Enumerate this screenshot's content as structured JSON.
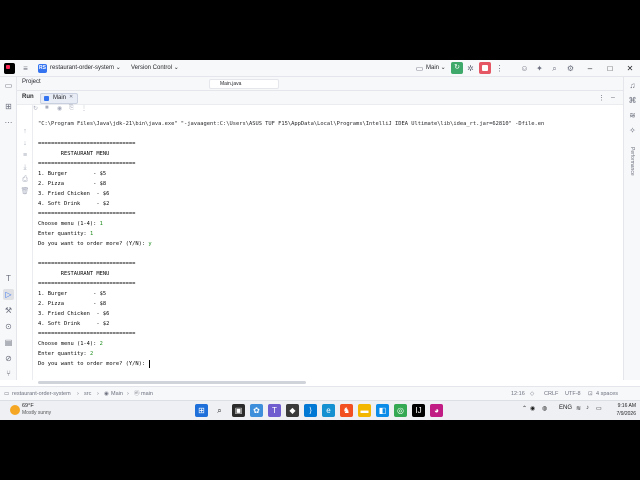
{
  "titlebar": {
    "project_badge": "RS",
    "project_name": "restaurant-order-system",
    "vcs": "Version Control",
    "run_config": "Main"
  },
  "project_row": {
    "label": "Project",
    "tab_label": "Main.java"
  },
  "run_panel": {
    "title": "Run",
    "tab_label": "Main"
  },
  "console": {
    "lines": [
      {
        "text": "\"C:\\Program Files\\Java\\jdk-21\\bin\\java.exe\" \"-javaagent:C:\\Users\\ASUS TUF F15\\AppData\\Local\\Programs\\IntelliJ IDEA Ultimate\\lib\\idea_rt.jar=62810\" -Dfile.en",
        "input": ""
      },
      {
        "text": "",
        "input": ""
      },
      {
        "text": "==============================",
        "input": ""
      },
      {
        "text": "       RESTAURANT MENU",
        "input": ""
      },
      {
        "text": "==============================",
        "input": ""
      },
      {
        "text": "1. Burger        - $5",
        "input": ""
      },
      {
        "text": "2. Pizza         - $8",
        "input": ""
      },
      {
        "text": "3. Fried Chicken  - $6",
        "input": ""
      },
      {
        "text": "4. Soft Drink     - $2",
        "input": ""
      },
      {
        "text": "==============================",
        "input": ""
      },
      {
        "text": "Choose menu (1-4): ",
        "input": "1"
      },
      {
        "text": "Enter quantity: ",
        "input": "1"
      },
      {
        "text": "Do you want to order more? (Y/N): ",
        "input": "y"
      },
      {
        "text": "",
        "input": ""
      },
      {
        "text": "==============================",
        "input": ""
      },
      {
        "text": "       RESTAURANT MENU",
        "input": ""
      },
      {
        "text": "==============================",
        "input": ""
      },
      {
        "text": "1. Burger        - $5",
        "input": ""
      },
      {
        "text": "2. Pizza         - $8",
        "input": ""
      },
      {
        "text": "3. Fried Chicken  - $6",
        "input": ""
      },
      {
        "text": "4. Soft Drink     - $2",
        "input": ""
      },
      {
        "text": "==============================",
        "input": ""
      },
      {
        "text": "Choose menu (1-4): ",
        "input": "2"
      },
      {
        "text": "Enter quantity: ",
        "input": "2"
      },
      {
        "text": "Do you want to order more? (Y/N): ",
        "input": ""
      }
    ]
  },
  "statusbar": {
    "breadcrumb": [
      "restaurant-order-system",
      "src",
      "Main",
      "main"
    ],
    "position": "12:16",
    "line_sep": "CRLF",
    "encoding": "UTF-8",
    "indent": "4 spaces"
  },
  "taskbar": {
    "weather_temp": "69°F",
    "weather_desc": "Mostly sunny",
    "lang": "ENG",
    "time": "9:16 AM",
    "date": "7/9/2026"
  },
  "right_strip": {
    "label": "Performance"
  }
}
